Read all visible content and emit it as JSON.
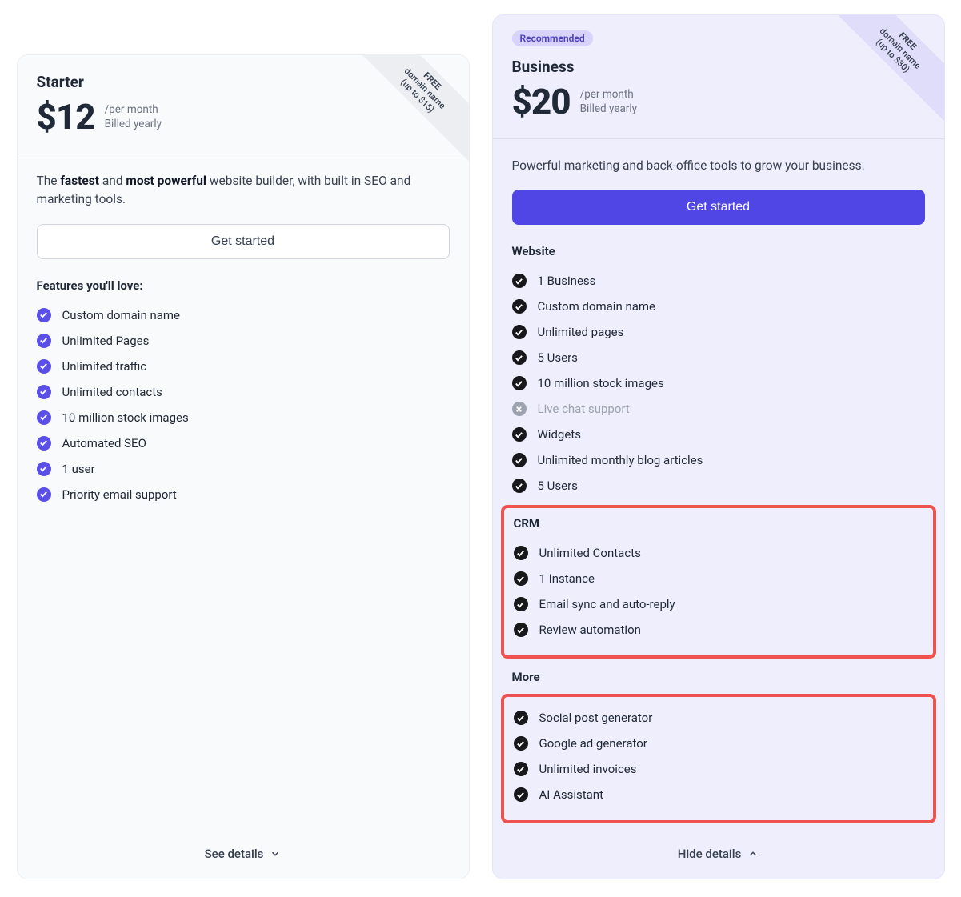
{
  "plans": {
    "starter": {
      "name": "Starter",
      "price": "$12",
      "per": "/per month",
      "billed": "Billed yearly",
      "ribbon": {
        "line1": "FREE",
        "line2": "domain name",
        "line3": "(up to $15)"
      },
      "desc_pre": "The ",
      "desc_b1": "fastest",
      "desc_mid": " and ",
      "desc_b2": "most powerful",
      "desc_post": " website builder, with built in SEO and marketing tools.",
      "cta": "Get started",
      "features_title": "Features you'll love:",
      "features": [
        "Custom domain name",
        "Unlimited Pages",
        "Unlimited traffic",
        "Unlimited contacts",
        "10 million stock images",
        "Automated SEO",
        "1 user",
        "Priority email support"
      ],
      "toggle": "See details"
    },
    "business": {
      "badge": "Recommended",
      "name": "Business",
      "price": "$20",
      "per": "/per month",
      "billed": "Billed yearly",
      "ribbon": {
        "line1": "FREE",
        "line2": "domain name",
        "line3": "(up to $30)"
      },
      "desc": "Powerful marketing and back-office tools to grow your business.",
      "cta": "Get started",
      "groups": {
        "website": {
          "title": "Website",
          "items": [
            {
              "label": "1 Business",
              "included": true
            },
            {
              "label": "Custom domain name",
              "included": true
            },
            {
              "label": "Unlimited pages",
              "included": true
            },
            {
              "label": "5 Users",
              "included": true
            },
            {
              "label": "10 million stock images",
              "included": true
            },
            {
              "label": "Live chat support",
              "included": false
            },
            {
              "label": "Widgets",
              "included": true
            },
            {
              "label": "Unlimited monthly blog articles",
              "included": true
            },
            {
              "label": "5 Users",
              "included": true
            }
          ]
        },
        "crm": {
          "title": "CRM",
          "items": [
            "Unlimited Contacts",
            "1 Instance",
            "Email sync and auto-reply",
            "Review automation"
          ]
        },
        "more": {
          "title": "More",
          "items": [
            "Social post generator",
            "Google ad generator",
            "Unlimited invoices",
            "AI Assistant"
          ]
        }
      },
      "toggle": "Hide details"
    }
  }
}
